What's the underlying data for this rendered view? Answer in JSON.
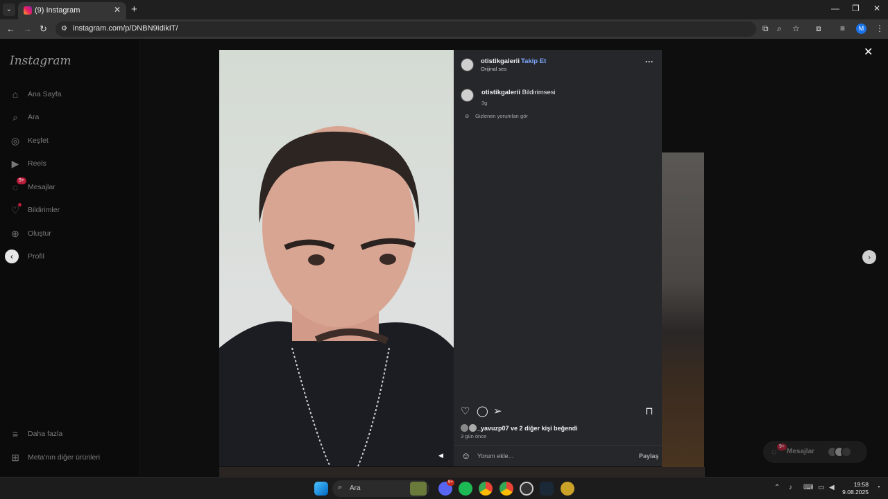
{
  "browser": {
    "tab_title": "(9) Instagram",
    "tab_close": "✕",
    "new_tab": "+",
    "url": "instagram.com/p/DNBN9IdikIT/",
    "profile_initial": "M",
    "minimize": "—",
    "restore": "❐",
    "close": "✕"
  },
  "sidebar": {
    "logo": "Instagram",
    "items": [
      {
        "label": "Ana Sayfa",
        "icon": "home-icon"
      },
      {
        "label": "Ara",
        "icon": "search-icon"
      },
      {
        "label": "Keşfet",
        "icon": "compass-icon"
      },
      {
        "label": "Reels",
        "icon": "reels-icon"
      },
      {
        "label": "Mesajlar",
        "icon": "messenger-icon",
        "badge": "9+"
      },
      {
        "label": "Bildirimler",
        "icon": "heart-icon"
      },
      {
        "label": "Oluştur",
        "icon": "plus-square-icon"
      },
      {
        "label": "Profil",
        "icon": "avatar-icon"
      }
    ],
    "more": "Daha fazla",
    "meta": "Meta'nın diğer ürünleri"
  },
  "post": {
    "username": "otistikgalerii",
    "follow": "Takip Et",
    "separator": "•",
    "audio": "Orijinal ses",
    "more": "···",
    "caption_user": "otistikgalerii",
    "caption_text": "Bildirimsesi",
    "caption_time": "3g",
    "hidden_comments": "Gizlenen yorumları gör",
    "likes_user": "_yavuzp07",
    "likes_rest": "ve 2 diğer kişi beğendi",
    "date": "3 gün önce",
    "comment_placeholder": "Yorum ekle...",
    "share": "Paylaş"
  },
  "messages_pill": {
    "label": "Mesajlar",
    "badge": "9+"
  },
  "taskbar": {
    "search": "Ara",
    "time": "19:58",
    "date": "9.08.2025",
    "discord_badge": "9+"
  }
}
